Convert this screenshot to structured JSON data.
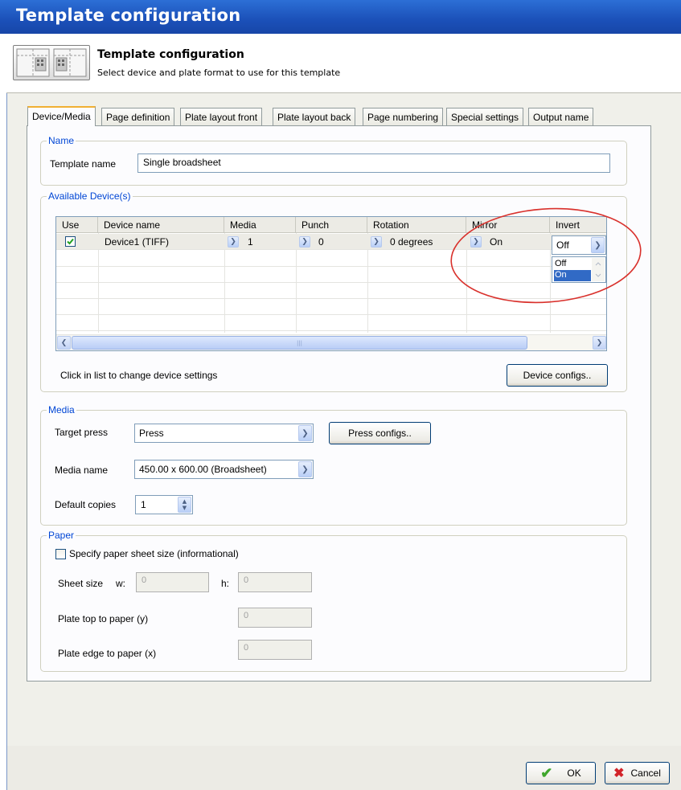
{
  "window": {
    "title": "Template configuration"
  },
  "header": {
    "title": "Template configuration",
    "subtitle": "Select device and plate format to use for this template"
  },
  "tabs": [
    {
      "label": "Device/Media"
    },
    {
      "label": "Page definition"
    },
    {
      "label": "Plate layout front"
    },
    {
      "label": "Plate layout back"
    },
    {
      "label": "Page numbering"
    },
    {
      "label": "Special settings"
    },
    {
      "label": "Output name"
    }
  ],
  "name_group": {
    "legend": "Name",
    "template_name_label": "Template name",
    "template_name_value": "Single broadsheet"
  },
  "devices_group": {
    "legend": "Available Device(s)",
    "columns": [
      "Use",
      "Device name",
      "Media",
      "Punch",
      "Rotation",
      "Mirror",
      "Invert"
    ],
    "row": {
      "use_checked": true,
      "device_name": "Device1 (TIFF)",
      "media": "1",
      "punch": "0",
      "rotation": "0 degrees",
      "mirror": "On",
      "invert": "Off"
    },
    "invert_options": [
      "Off",
      "On"
    ],
    "highlighted_option": "On",
    "hint": "Click in list to change device settings",
    "device_configs_button": "Device configs.."
  },
  "media_group": {
    "legend": "Media",
    "target_press_label": "Target press",
    "target_press_value": "Press",
    "press_configs_button": "Press configs..",
    "media_name_label": "Media name",
    "media_name_value": "450.00 x 600.00 (Broadsheet)",
    "default_copies_label": "Default copies",
    "default_copies_value": "1"
  },
  "paper_group": {
    "legend": "Paper",
    "specify_checkbox_label": "Specify paper sheet size (informational)",
    "specify_checked": false,
    "sheet_size_label": "Sheet size",
    "w_label": "w:",
    "w_value": "0",
    "h_label": "h:",
    "h_value": "0",
    "plate_top_label": "Plate top to paper (y)",
    "plate_top_value": "0",
    "plate_edge_label": "Plate edge to paper (x)",
    "plate_edge_value": "0"
  },
  "footer": {
    "ok_label": "OK",
    "cancel_label": "Cancel"
  },
  "colors": {
    "titlebar": "#1b50b8",
    "group_label": "#0046d5",
    "highlight": "#316ac5",
    "annotation_circle": "#d9312c"
  }
}
